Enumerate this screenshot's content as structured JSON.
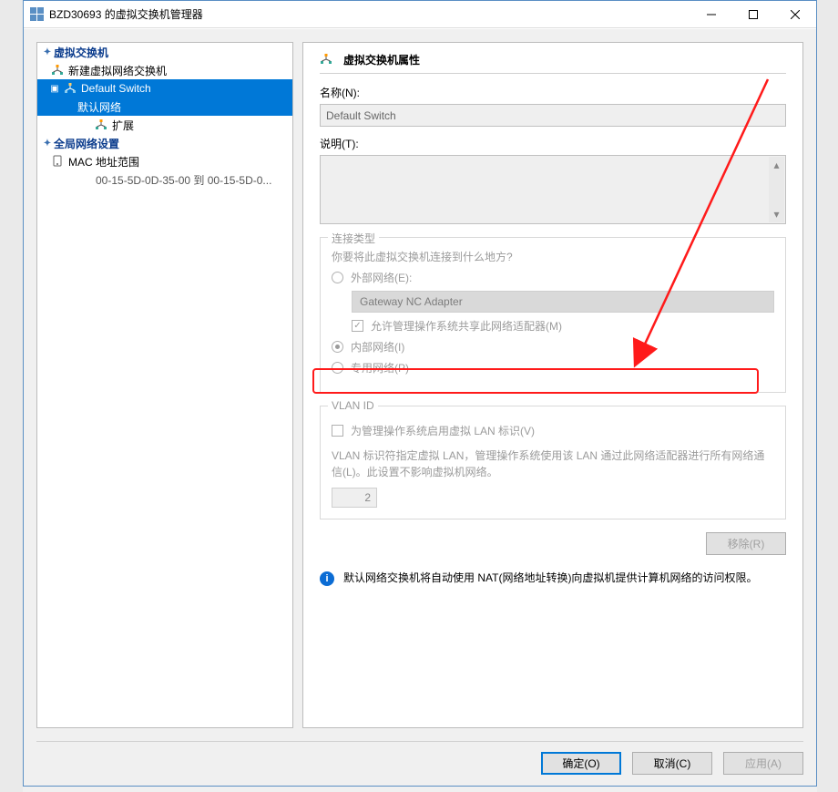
{
  "window": {
    "title": "BZD30693 的虚拟交换机管理器"
  },
  "tree": {
    "section1": "虚拟交换机",
    "new_switch": "新建虚拟网络交换机",
    "default_switch": "Default Switch",
    "default_network": "默认网络",
    "extension": "扩展",
    "section2": "全局网络设置",
    "mac_range": "MAC 地址范围",
    "mac_detail": "00-15-5D-0D-35-00 到 00-15-5D-0..."
  },
  "props": {
    "header": "虚拟交换机属性",
    "name_label": "名称(N):",
    "name_value": "Default Switch",
    "desc_label": "说明(T):",
    "conn_group": "连接类型",
    "conn_question": "你要将此虚拟交换机连接到什么地方?",
    "opt_external": "外部网络(E):",
    "adapter": "Gateway NC Adapter",
    "allow_mgmt": "允许管理操作系统共享此网络适配器(M)",
    "opt_internal": "内部网络(I)",
    "opt_private": "专用网络(P)",
    "vlan_group": "VLAN ID",
    "vlan_enable": "为管理操作系统启用虚拟 LAN 标识(V)",
    "vlan_desc": "VLAN 标识符指定虚拟 LAN，管理操作系统使用该 LAN 通过此网络适配器进行所有网络通信(L)。此设置不影响虚拟机网络。",
    "vlan_value": "2",
    "remove": "移除(R)",
    "info": "默认网络交换机将自动使用 NAT(网络地址转换)向虚拟机提供计算机网络的访问权限。"
  },
  "buttons": {
    "ok": "确定(O)",
    "cancel": "取消(C)",
    "apply": "应用(A)"
  }
}
